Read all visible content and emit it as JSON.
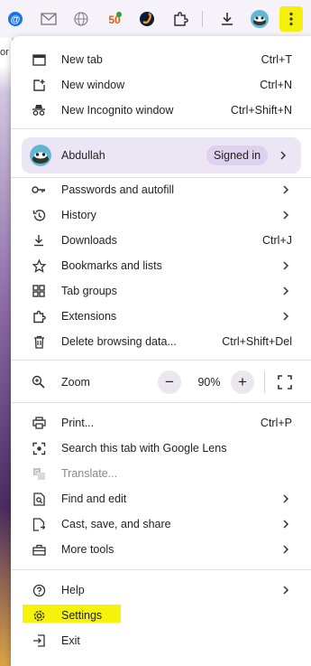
{
  "toolbar": {
    "icons": [
      "at-sign-icon",
      "mail-icon",
      "globe-icon",
      "fifty-badge-icon",
      "s-app-icon",
      "extensions-puzzle-icon",
      "download-icon",
      "profile-avatar-icon",
      "more-menu-icon"
    ],
    "highlight_color": "#f4f00a"
  },
  "left_fragment": "or",
  "menu": {
    "group1": [
      {
        "label": "New tab",
        "shortcut": "Ctrl+T",
        "icon": "new-tab-icon"
      },
      {
        "label": "New window",
        "shortcut": "Ctrl+N",
        "icon": "new-window-icon"
      },
      {
        "label": "New Incognito window",
        "shortcut": "Ctrl+Shift+N",
        "icon": "incognito-icon"
      }
    ],
    "profile": {
      "name": "Abdullah",
      "status": "Signed in"
    },
    "group2": [
      {
        "label": "Passwords and autofill",
        "icon": "key-icon"
      },
      {
        "label": "History",
        "icon": "history-icon"
      },
      {
        "label": "Downloads",
        "shortcut": "Ctrl+J",
        "icon": "download-icon"
      },
      {
        "label": "Bookmarks and lists",
        "icon": "star-icon"
      },
      {
        "label": "Tab groups",
        "icon": "tab-groups-icon"
      },
      {
        "label": "Extensions",
        "icon": "puzzle-icon"
      },
      {
        "label": "Delete browsing data...",
        "shortcut": "Ctrl+Shift+Del",
        "icon": "trash-icon"
      }
    ],
    "zoom": {
      "label": "Zoom",
      "value": "90%",
      "minus": "−",
      "plus": "+"
    },
    "group3": [
      {
        "label": "Print...",
        "shortcut": "Ctrl+P",
        "icon": "print-icon"
      },
      {
        "label": "Search this tab with Google Lens",
        "icon": "lens-icon"
      },
      {
        "label": "Translate...",
        "icon": "translate-icon"
      },
      {
        "label": "Find and edit",
        "icon": "find-icon"
      },
      {
        "label": "Cast, save, and share",
        "icon": "cast-icon"
      },
      {
        "label": "More tools",
        "icon": "toolbox-icon"
      }
    ],
    "group4": [
      {
        "label": "Help",
        "icon": "help-icon"
      },
      {
        "label": "Settings",
        "icon": "settings-gear-icon"
      },
      {
        "label": "Exit",
        "icon": "exit-icon"
      }
    ]
  }
}
